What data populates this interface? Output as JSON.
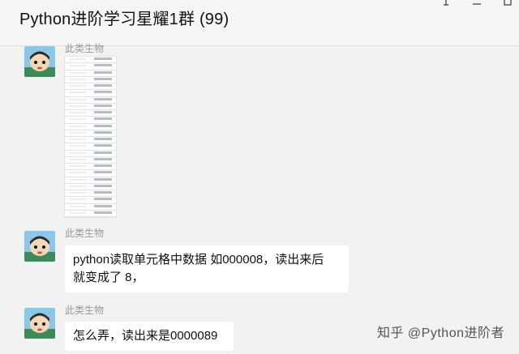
{
  "window": {
    "title": "Python进阶学习星耀1群 (99)",
    "controls": {
      "pin_icon": "pin-icon",
      "minimize_icon": "minimize-icon",
      "maximize_icon": "maximize-icon"
    }
  },
  "messages": [
    {
      "sender": "此类生物",
      "type": "image",
      "image_rows": 24
    },
    {
      "sender": "此类生物",
      "type": "text",
      "lines": [
        "python读取单元格中数据 如000008，读出来后",
        "就变成了 8，"
      ]
    },
    {
      "sender": "此类生物",
      "type": "text",
      "lines": [
        "怎么弄，读出来是0000089"
      ]
    }
  ],
  "watermark": "知乎 @Python进阶者"
}
